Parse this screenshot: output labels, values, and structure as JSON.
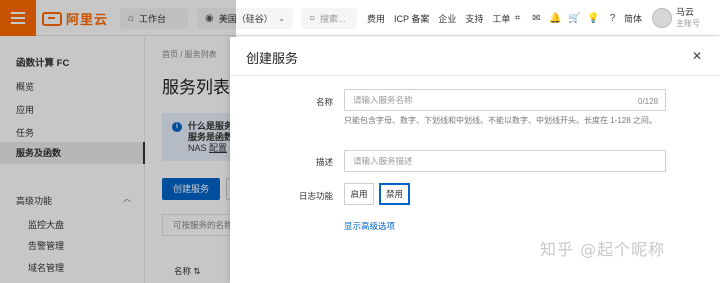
{
  "header": {
    "logo_text": "阿里云",
    "workbench": "工作台",
    "region": "美国（硅谷）",
    "search_placeholder": "搜索...",
    "links": [
      "费用",
      "ICP 备案",
      "企业",
      "支持",
      "工单"
    ],
    "lang": "简体",
    "user_name": "马云",
    "user_role": "主账号"
  },
  "sidebar": {
    "title": "函数计算 FC",
    "items": [
      "概览",
      "应用",
      "任务",
      "服务及函数"
    ],
    "active_index": 3,
    "group_label": "高级功能",
    "sub_items": [
      "监控大盘",
      "告警管理",
      "域名管理"
    ]
  },
  "main": {
    "breadcrumb": "首页 / 服务列表",
    "page_title": "服务列表",
    "info_line1": "什么是服务",
    "info_line2": "服务是函数",
    "info_line3_prefix": "NAS ",
    "info_line3_link": "配置",
    "create_button": "创建服务",
    "filter_placeholder": "可按服务的名称",
    "column_name": "名称 ⇅"
  },
  "drawer": {
    "title": "创建服务",
    "name_label": "名称",
    "name_placeholder": "请输入服务名称",
    "name_counter": "0/128",
    "name_hint": "只能包含字母、数字、下划线和中划线。不能以数字、中划线开头。长度在 1-128 之间。",
    "desc_label": "描述",
    "desc_placeholder": "请输入服务描述",
    "log_label": "日志功能",
    "log_enable": "启用",
    "log_disable": "禁用",
    "log_selected": "禁用",
    "advanced_link": "显示高级选项"
  },
  "watermark": "知乎 @起个昵称",
  "colors": {
    "brand": "#ff6a00",
    "primary": "#0064c8"
  }
}
